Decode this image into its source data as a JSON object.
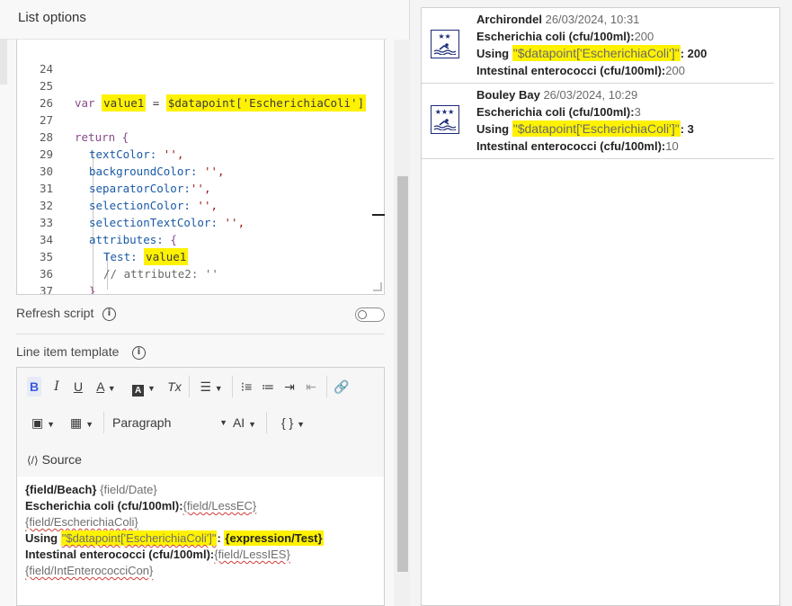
{
  "panel": {
    "title": "List options"
  },
  "code_editor": {
    "lines": [
      {
        "num": "24"
      },
      {
        "num": "25",
        "kw": "var",
        "var": "value1",
        "eq": "=",
        "expr": "$datapoint['EscherichiaColi']"
      },
      {
        "num": "26"
      },
      {
        "num": "27",
        "text": "return {"
      },
      {
        "num": "28",
        "prop": "textColor:",
        "val": "'',"
      },
      {
        "num": "29",
        "prop": "backgroundColor:",
        "val": "'',"
      },
      {
        "num": "30",
        "prop": "separatorColor:",
        "val": "'',"
      },
      {
        "num": "31",
        "prop": "selectionColor:",
        "val": "'',"
      },
      {
        "num": "32",
        "prop": "selectionTextColor:",
        "val": "'',"
      },
      {
        "num": "33",
        "prop": "attributes:",
        "val": "{"
      },
      {
        "num": "34",
        "prop": "Test:",
        "val": "value1"
      },
      {
        "num": "35",
        "text": "// attribute2: ''"
      },
      {
        "num": "36",
        "text": "}"
      },
      {
        "num": "37",
        "text": "}"
      }
    ]
  },
  "refresh": {
    "label": "Refresh script",
    "enabled": false
  },
  "template": {
    "label": "Line item template",
    "toolbar": {
      "paragraph_label": "Paragraph",
      "source_label": "Source",
      "bold": "B",
      "italic": "I",
      "underline": "U",
      "font_color": "A",
      "clear_format": "Tx",
      "font_size": "AI",
      "braces": "{ }"
    },
    "content": {
      "l1_a": "{field/Beach}",
      "l1_b": "{field/Date}",
      "l2_a": "Escherichia coli (cfu/100ml):",
      "l2_b": "{field/LessEC}",
      "l3": "{field/EscherichiaColi}",
      "l4_a": "Using ",
      "l4_b": "\"$datapoint['EscherichiaColi']\"",
      "l4_c": ": ",
      "l4_d": "{expression/Test}",
      "l5_a": "Intestinal enterococci (cfu/100ml):",
      "l5_b": "{field/LessIES}",
      "l6": "{field/IntEnterococciCon}"
    }
  },
  "preview": {
    "items": [
      {
        "beach": "Archirondel",
        "date": "26/03/2024, 10:31",
        "ec_label": "Escherichia coli (cfu/100ml):",
        "ec_value": "200",
        "using_label": "Using ",
        "using_expr": "\"$datapoint['EscherichiaColi']\"",
        "using_sep": ": ",
        "using_value": "200",
        "ie_label": "Intestinal enterococci (cfu/100ml):",
        "ie_value": "200",
        "stars": "★★"
      },
      {
        "beach": "Bouley Bay",
        "date": "26/03/2024, 10:29",
        "ec_label": "Escherichia coli (cfu/100ml):",
        "ec_value": "3",
        "using_label": "Using ",
        "using_expr": "\"$datapoint['EscherichiaColi']\"",
        "using_sep": ": ",
        "using_value": "3",
        "ie_label": "Intestinal enterococci (cfu/100ml):",
        "ie_value": "10",
        "stars": "★★★"
      }
    ]
  },
  "colors": {
    "highlight": "#fff200",
    "icon_blue": "#1b2a7a",
    "accent_blue": "#3b5bdb"
  }
}
